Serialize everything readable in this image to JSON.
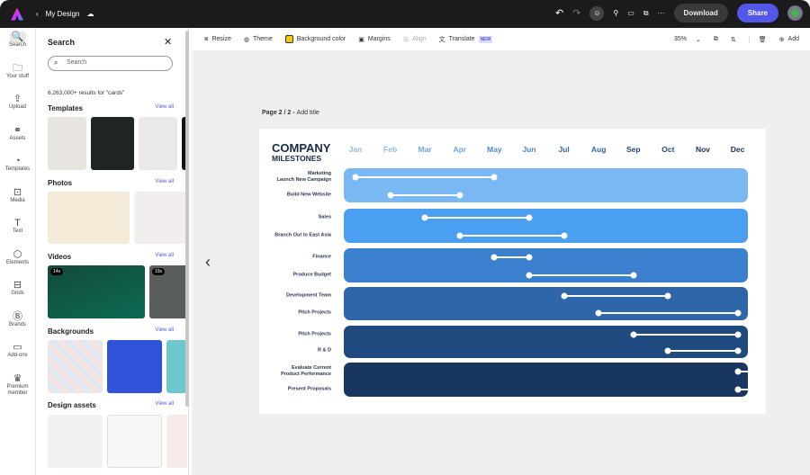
{
  "topbar": {
    "title": "My Design",
    "download": "Download",
    "share": "Share"
  },
  "rail": [
    {
      "icon": "search-icon",
      "g": "🔍",
      "label": "Search"
    },
    {
      "icon": "folder-icon",
      "g": "🗀",
      "label": "Your stuff"
    },
    {
      "icon": "upload-icon",
      "g": "⇪",
      "label": "Upload"
    },
    {
      "icon": "assets-icon",
      "g": "⚭",
      "label": "Assets"
    },
    {
      "icon": "templates-icon",
      "g": "◔",
      "label": "Templates"
    },
    {
      "icon": "media-icon",
      "g": "⊡",
      "label": "Media"
    },
    {
      "icon": "text-icon",
      "g": "T",
      "label": "Text"
    },
    {
      "icon": "elements-icon",
      "g": "⬡",
      "label": "Elements"
    },
    {
      "icon": "grids-icon",
      "g": "⊟",
      "label": "Grids"
    },
    {
      "icon": "brands-icon",
      "g": "Ⓑ",
      "label": "Brands"
    },
    {
      "icon": "addons-icon",
      "g": "▭",
      "label": "Add-ons"
    },
    {
      "icon": "crown-icon",
      "g": "♛",
      "label": "Premium member"
    }
  ],
  "panel": {
    "title": "Search",
    "search_value": "Search",
    "results": "6,263,000+ results for \"cards\"",
    "view_all": "View all",
    "sections": [
      "Templates",
      "Photos",
      "Videos",
      "Backgrounds",
      "Design assets"
    ],
    "video_durations": [
      "14s",
      "19s"
    ]
  },
  "toolbar": {
    "resize": "Resize",
    "theme": "Theme",
    "background": "Background color",
    "margins": "Margins",
    "align": "Align",
    "translate": "Translate",
    "new": "NEW",
    "zoom": "35%",
    "add": "Add"
  },
  "page_label": "Page 2 / 2 - ",
  "page_title_placeholder": "Add title",
  "chart_data": {
    "type": "gantt",
    "title": "COMPANY",
    "subtitle": "MILESTONES",
    "months": [
      "Jan",
      "Feb",
      "Mar",
      "Apr",
      "May",
      "Jun",
      "Jul",
      "Aug",
      "Sep",
      "Oct",
      "Nov",
      "Dec"
    ],
    "month_colors": [
      "#8cbcec",
      "#8cbcec",
      "#6aa6e4",
      "#6aa6e4",
      "#4a88d0",
      "#4a88d0",
      "#2e65a8",
      "#2e65a8",
      "#1e4a80",
      "#1e4a80",
      "#173660",
      "#173660"
    ],
    "groups": [
      {
        "color": "#7ab8f3",
        "tasks": [
          {
            "label": "Marketing\nLaunch New Campaign",
            "start": 0,
            "end": 4
          },
          {
            "label": "Build New Website",
            "start": 1,
            "end": 3
          }
        ]
      },
      {
        "color": "#4b9ff0",
        "tasks": [
          {
            "label": "Sales",
            "start": 2,
            "end": 5
          },
          {
            "label": "Branch Out to East Asia",
            "start": 3,
            "end": 6
          }
        ]
      },
      {
        "color": "#3b7fcf",
        "tasks": [
          {
            "label": "Finance",
            "start": 4,
            "end": 5
          },
          {
            "label": "Produce Budget",
            "start": 5,
            "end": 8
          }
        ]
      },
      {
        "color": "#2e66a9",
        "tasks": [
          {
            "label": "Development Team",
            "start": 6,
            "end": 9
          },
          {
            "label": "Pitch Projects",
            "start": 7,
            "end": 11
          }
        ]
      },
      {
        "color": "#1f4a80",
        "tasks": [
          {
            "label": "Pitch Projects",
            "start": 8,
            "end": 11
          },
          {
            "label": "R & D",
            "start": 9,
            "end": 11
          }
        ]
      },
      {
        "color": "#183660",
        "tasks": [
          {
            "label": "Evaluate Current\nProduct Performance",
            "start": 11,
            "end": 11.7
          },
          {
            "label": "Present Proposals",
            "start": 11,
            "end": 11.7
          }
        ]
      }
    ]
  }
}
